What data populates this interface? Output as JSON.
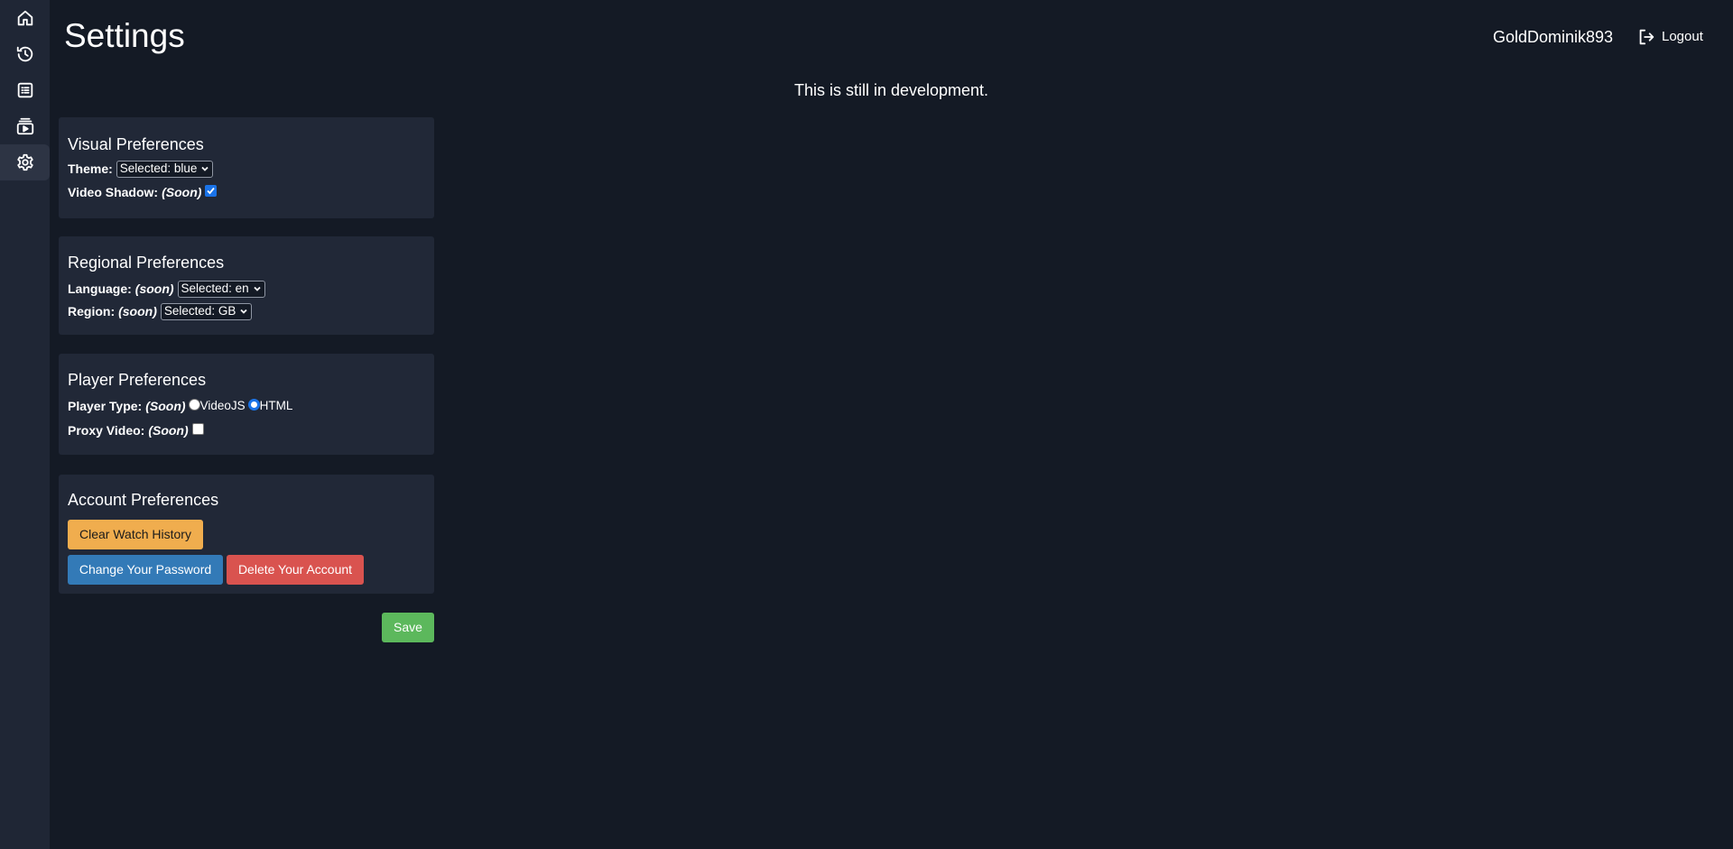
{
  "sidebar": {
    "items": [
      {
        "icon": "home-icon",
        "label": "Home"
      },
      {
        "icon": "history-icon",
        "label": "History"
      },
      {
        "icon": "list-icon",
        "label": "Playlists"
      },
      {
        "icon": "subscriptions-icon",
        "label": "Subscriptions"
      },
      {
        "icon": "gear-icon",
        "label": "Settings"
      }
    ],
    "active_index": 4
  },
  "header": {
    "title": "Settings",
    "username": "GoldDominik893",
    "logout_label": "Logout"
  },
  "notice": "This is still in development.",
  "visual": {
    "heading": "Visual Preferences",
    "theme_label": "Theme:",
    "theme_value": "Selected: blue",
    "shadow_label": "Video Shadow:",
    "shadow_note": "(Soon)",
    "shadow_checked": true
  },
  "regional": {
    "heading": "Regional Preferences",
    "language_label": "Language:",
    "language_note": "(soon)",
    "language_value": "Selected: en",
    "region_label": "Region:",
    "region_note": "(soon)",
    "region_value": "Selected: GB"
  },
  "player": {
    "heading": "Player Preferences",
    "type_label": "Player Type:",
    "type_note": "(Soon)",
    "options": [
      "VideoJS",
      "HTML"
    ],
    "selected_option": "HTML",
    "proxy_label": "Proxy Video:",
    "proxy_note": "(Soon)",
    "proxy_checked": false
  },
  "account": {
    "heading": "Account Preferences",
    "clear_history_label": "Clear Watch History",
    "change_password_label": "Change Your Password",
    "delete_account_label": "Delete Your Account"
  },
  "save_label": "Save",
  "colors": {
    "background": "#141a25",
    "sidebar": "#1f2635",
    "card": "#212837",
    "warning": "#f0ad4e",
    "primary": "#337ab7",
    "danger": "#d9534f",
    "success": "#5cb85c"
  }
}
